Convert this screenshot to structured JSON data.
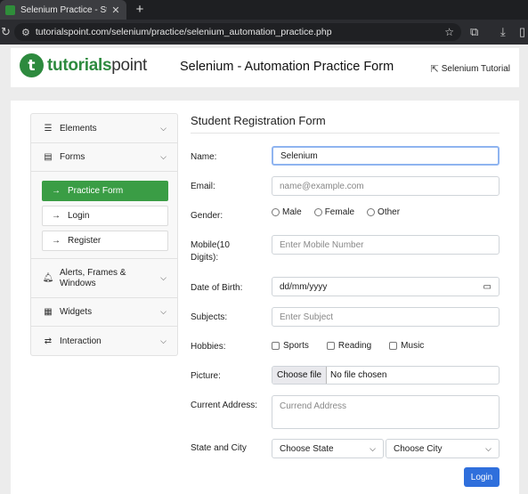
{
  "browser": {
    "tab_title": "Selenium Practice - Student",
    "tab_close": "✕",
    "new_tab": "+",
    "url": "tutorialspoint.com/selenium/practice/selenium_automation_practice.php"
  },
  "header": {
    "logo_mark": "t",
    "logo_part1": "tutorials",
    "logo_part2": "point",
    "title": "Selenium - Automation Practice Form",
    "tutorial_link": "Selenium Tutorial"
  },
  "sidebar": {
    "elements": "Elements",
    "forms": "Forms",
    "form_items": [
      "Practice Form",
      "Login",
      "Register"
    ],
    "alerts": "Alerts, Frames & Windows",
    "widgets": "Widgets",
    "interaction": "Interaction"
  },
  "form": {
    "title": "Student Registration Form",
    "name_label": "Name:",
    "name_value": "Selenium",
    "email_label": "Email:",
    "email_placeholder": "name@example.com",
    "gender_label": "Gender:",
    "gender_options": [
      "Male",
      "Female",
      "Other"
    ],
    "mobile_label_1": "Mobile(10",
    "mobile_label_2": "Digits):",
    "mobile_placeholder": "Enter Mobile Number",
    "dob_label": "Date of Birth:",
    "dob_placeholder": "dd/mm/yyyy",
    "subjects_label": "Subjects:",
    "subjects_placeholder": "Enter Subject",
    "hobbies_label": "Hobbies:",
    "hobbies_options": [
      "Sports",
      "Reading",
      "Music"
    ],
    "picture_label": "Picture:",
    "file_button": "Choose file",
    "file_status": "No file chosen",
    "address_label": "Current Address:",
    "address_placeholder": "Currend Address",
    "state_city_label": "State and City",
    "state_placeholder": "Choose State",
    "city_placeholder": "Choose City",
    "submit": "Login"
  }
}
